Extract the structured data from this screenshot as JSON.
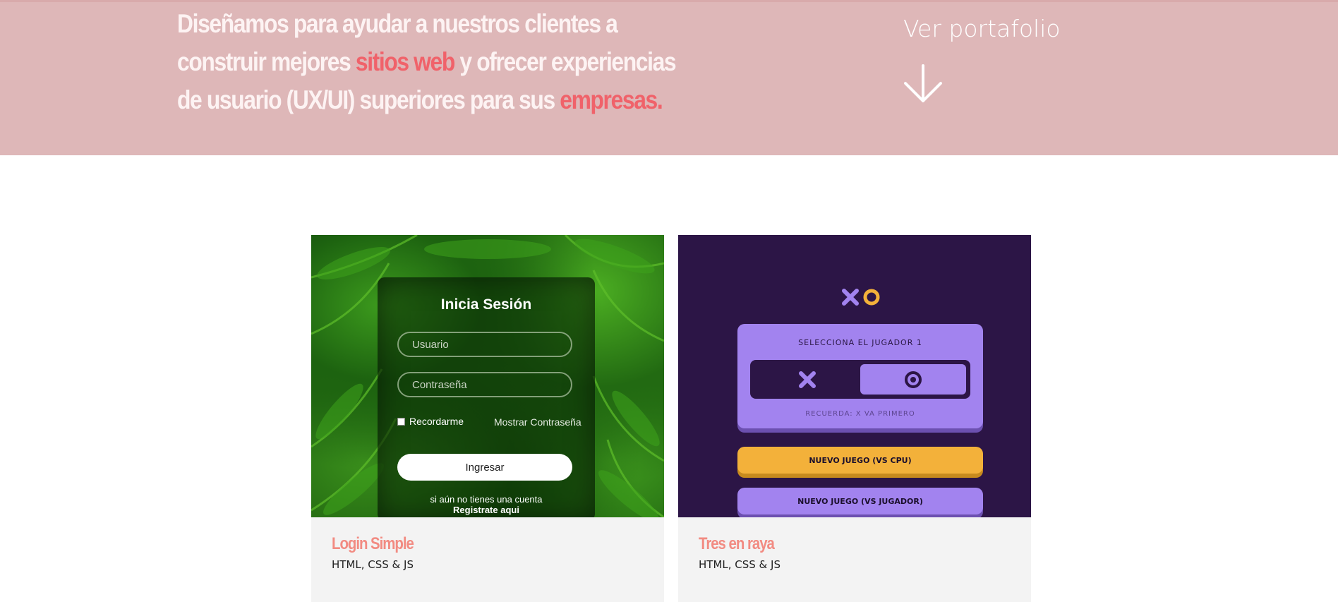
{
  "hero": {
    "text_part1": "Diseñamos para ayudar a nuestros clientes a construir mejores ",
    "highlight1": "sitios web",
    "text_part2": " y ofrecer experiencias de usuario (UX/UI) superiores para sus ",
    "highlight2": "empresas.",
    "cta_label": "Ver portafolio",
    "arrow_icon": "arrow-down-icon",
    "bg_color": "#deb7b8",
    "highlight_color": "#f0626a"
  },
  "projects": [
    {
      "title": "Login Simple",
      "tech": "HTML, CSS & JS",
      "preview": {
        "heading": "Inicia Sesión",
        "user_placeholder": "Usuario",
        "pass_placeholder": "Contraseña",
        "remember_label": "Recordarme",
        "show_password_label": "Mostrar Contraseña",
        "submit_label": "Ingresar",
        "footer_line1": "si aún no tienes una cuenta",
        "footer_line2": "Registrate aqui"
      }
    },
    {
      "title": "Tres en raya",
      "tech": "HTML, CSS & JS",
      "preview": {
        "select_label": "SELECCIONA EL JUGADOR 1",
        "note": "RECUERDA: X VA PRIMERO",
        "cpu_button": "NUEVO JUEGO (VS CPU)",
        "player_button": "NUEVO JUEGO (VS JUGADOR)",
        "colors": {
          "bg": "#2c1546",
          "purple": "#a283ef",
          "yellow": "#f3b13a"
        }
      }
    }
  ],
  "title_color": "#f28b82"
}
